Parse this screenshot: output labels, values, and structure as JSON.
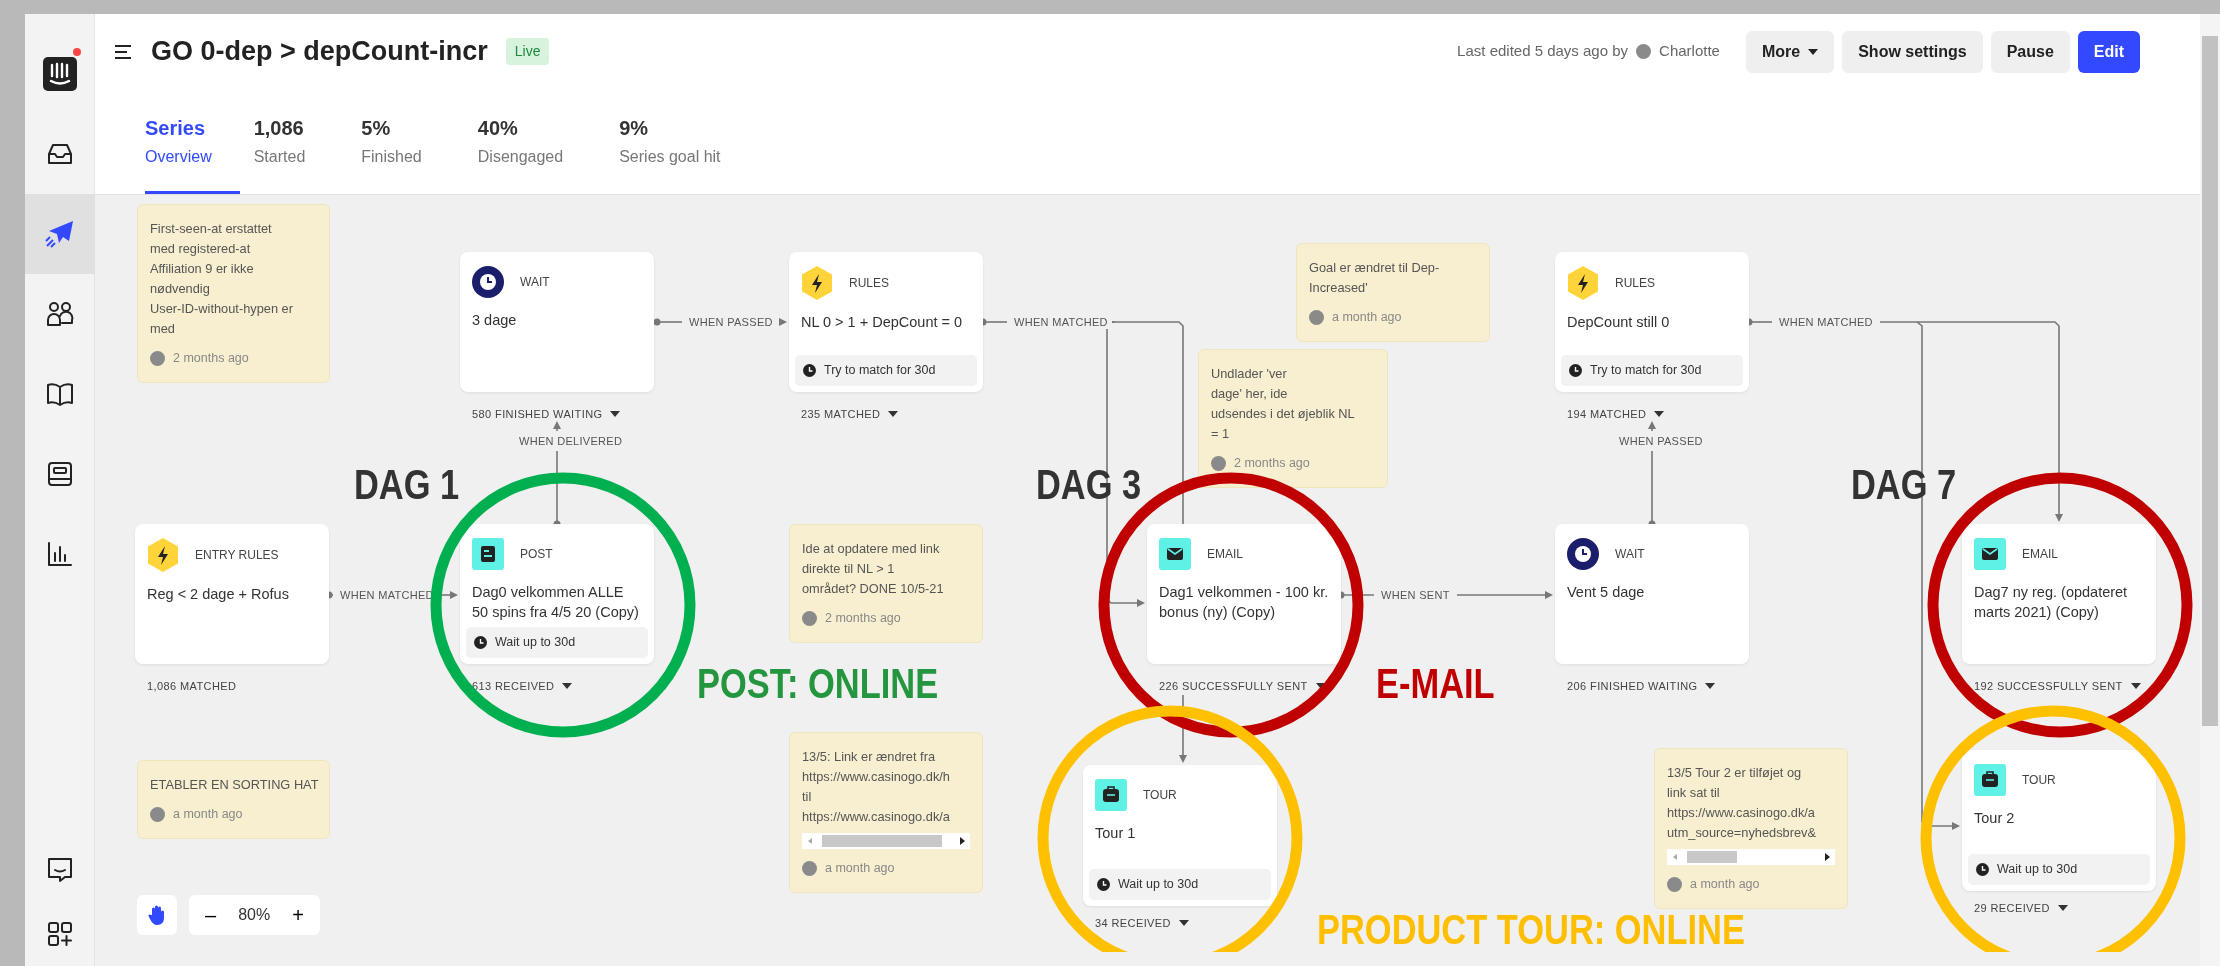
{
  "sidebar": {
    "logo": {
      "notification": true
    },
    "items": [
      {
        "kind": "inbox",
        "selected": false
      },
      {
        "kind": "outbound",
        "selected": true
      },
      {
        "kind": "people",
        "selected": false
      },
      {
        "kind": "book",
        "selected": false
      },
      {
        "kind": "article",
        "selected": false
      },
      {
        "kind": "reports",
        "selected": false
      }
    ],
    "bottom_items": [
      {
        "kind": "chat"
      },
      {
        "kind": "apps"
      }
    ]
  },
  "header": {
    "title": "GO 0-dep > depCount-incr",
    "status_badge": "Live",
    "last_edited": "Last edited 5 days ago by",
    "editor": "Charlotte",
    "buttons": [
      {
        "label": "More",
        "kind": "dropdown"
      },
      {
        "label": "Show settings",
        "kind": "secondary"
      },
      {
        "label": "Pause",
        "kind": "secondary"
      },
      {
        "label": "Edit",
        "kind": "primary"
      }
    ]
  },
  "tabs": [
    {
      "value": "Series",
      "label": "Overview",
      "selected": true
    },
    {
      "value": "1,086",
      "label": "Started",
      "selected": false
    },
    {
      "value": "5%",
      "label": "Finished",
      "selected": false
    },
    {
      "value": "40%",
      "label": "Disengaged",
      "selected": false
    },
    {
      "value": "9%",
      "label": "Series goal hit",
      "selected": false
    }
  ],
  "canvas": {
    "notes": [
      {
        "lines": [
          "First-seen-at erstattet",
          "med registered-at",
          "Affiliation 9 er ikke",
          "nødvendig",
          "User-ID-without-hypen er",
          "med"
        ],
        "time": "2 months ago",
        "scrollbar": false
      },
      {
        "lines": [
          "Undlader 'ver",
          "dage' her, ide",
          "udsendes i det øjeblik NL",
          "= 1"
        ],
        "time": "2 months ago",
        "scrollbar": false
      },
      {
        "lines": [
          "Goal er ændret til Dep-",
          "Increased'"
        ],
        "time": "a month ago",
        "scrollbar": false
      },
      {
        "lines": [
          "Ide at opdatere med link",
          "direkte til NL > 1",
          "området? DONE 10/5-21"
        ],
        "time": "2 months ago",
        "scrollbar": false
      },
      {
        "lines": [
          "ETABLER EN SORTING HAT"
        ],
        "time": "a month ago",
        "scrollbar": false
      },
      {
        "lines": [
          "13/5: Link er ændret fra",
          "https://www.casinogo.dk/h",
          "til",
          "https://www.casinogo.dk/a"
        ],
        "time": "a month ago",
        "scrollbar": true
      },
      {
        "lines": [
          "13/5 Tour 2 er tilføjet og",
          "link sat til",
          "https://www.casinogo.dk/a",
          "utm_source=nyhedsbrev&"
        ],
        "time": "a month ago",
        "scrollbar": true
      }
    ],
    "steps": [
      {
        "kind": "wait",
        "type": "WAIT",
        "title": "3 dage",
        "stat": "580 FINISHED WAITING",
        "dropdown": true
      },
      {
        "kind": "rules",
        "type": "RULES",
        "title": "NL 0 > 1 + DepCount = 0",
        "footer": "Try to match for 30d",
        "stat": "235 MATCHED",
        "dropdown": true
      },
      {
        "kind": "rules",
        "type": "RULES",
        "title": "DepCount still 0",
        "footer": "Try to match for 30d",
        "stat": "194 MATCHED",
        "dropdown": true
      },
      {
        "kind": "rules",
        "type": "ENTRY RULES",
        "title": "Reg < 2 dage + Rofus",
        "stat": "1,086 MATCHED",
        "dropdown": false
      },
      {
        "kind": "post",
        "type": "POST",
        "title": "Dag0 velkommen ALLE 50 spins fra 4/5 20 (Copy)",
        "footer": "Wait up to 30d",
        "stat": "613 RECEIVED",
        "dropdown": true
      },
      {
        "kind": "email",
        "type": "EMAIL",
        "title": "Dag1 velkommen - 100 kr. bonus (ny) (Copy)",
        "stat": "226 SUCCESSFULLY SENT",
        "dropdown": true
      },
      {
        "kind": "wait",
        "type": "WAIT",
        "title": "Vent 5 dage",
        "stat": "206 FINISHED WAITING",
        "dropdown": true
      },
      {
        "kind": "email",
        "type": "EMAIL",
        "title": "Dag7 ny reg. (opdateret marts 2021) (Copy)",
        "stat": "192 SUCCESSFULLY SENT",
        "dropdown": true
      },
      {
        "kind": "tour",
        "type": "TOUR",
        "title": "Tour 1",
        "footer": "Wait up to 30d",
        "stat": "34 RECEIVED",
        "dropdown": true
      },
      {
        "kind": "tour",
        "type": "TOUR",
        "title": "Tour 2",
        "footer": "Wait up to 30d",
        "stat": "29 RECEIVED",
        "dropdown": true
      }
    ],
    "connectors": [
      {
        "label": "WHEN PASSED"
      },
      {
        "label": "WHEN MATCHED"
      },
      {
        "label": "WHEN DELIVERED"
      },
      {
        "label": "WHEN MATCHED"
      },
      {
        "label": "WHEN SENT"
      },
      {
        "label": "WHEN PASSED"
      },
      {
        "label": "WHEN MATCHED"
      }
    ],
    "zoom": {
      "minus": "–",
      "value": "80%",
      "plus": "+"
    }
  },
  "annotations": {
    "labels": [
      {
        "text": "DAG 1",
        "color": "#333333"
      },
      {
        "text": "DAG 3",
        "color": "#333333"
      },
      {
        "text": "DAG 7",
        "color": "#333333"
      },
      {
        "text": "POST: ONLINE",
        "color": "#24963f"
      },
      {
        "text": "E-MAIL",
        "color": "#c00000"
      },
      {
        "text": "PRODUCT TOUR: ONLINE",
        "color": "#ffbf00"
      }
    ],
    "circles": [
      {
        "color": "#00b050"
      },
      {
        "color": "#c00000"
      },
      {
        "color": "#ffc000"
      },
      {
        "color": "#c00000"
      },
      {
        "color": "#ffc000"
      }
    ]
  }
}
